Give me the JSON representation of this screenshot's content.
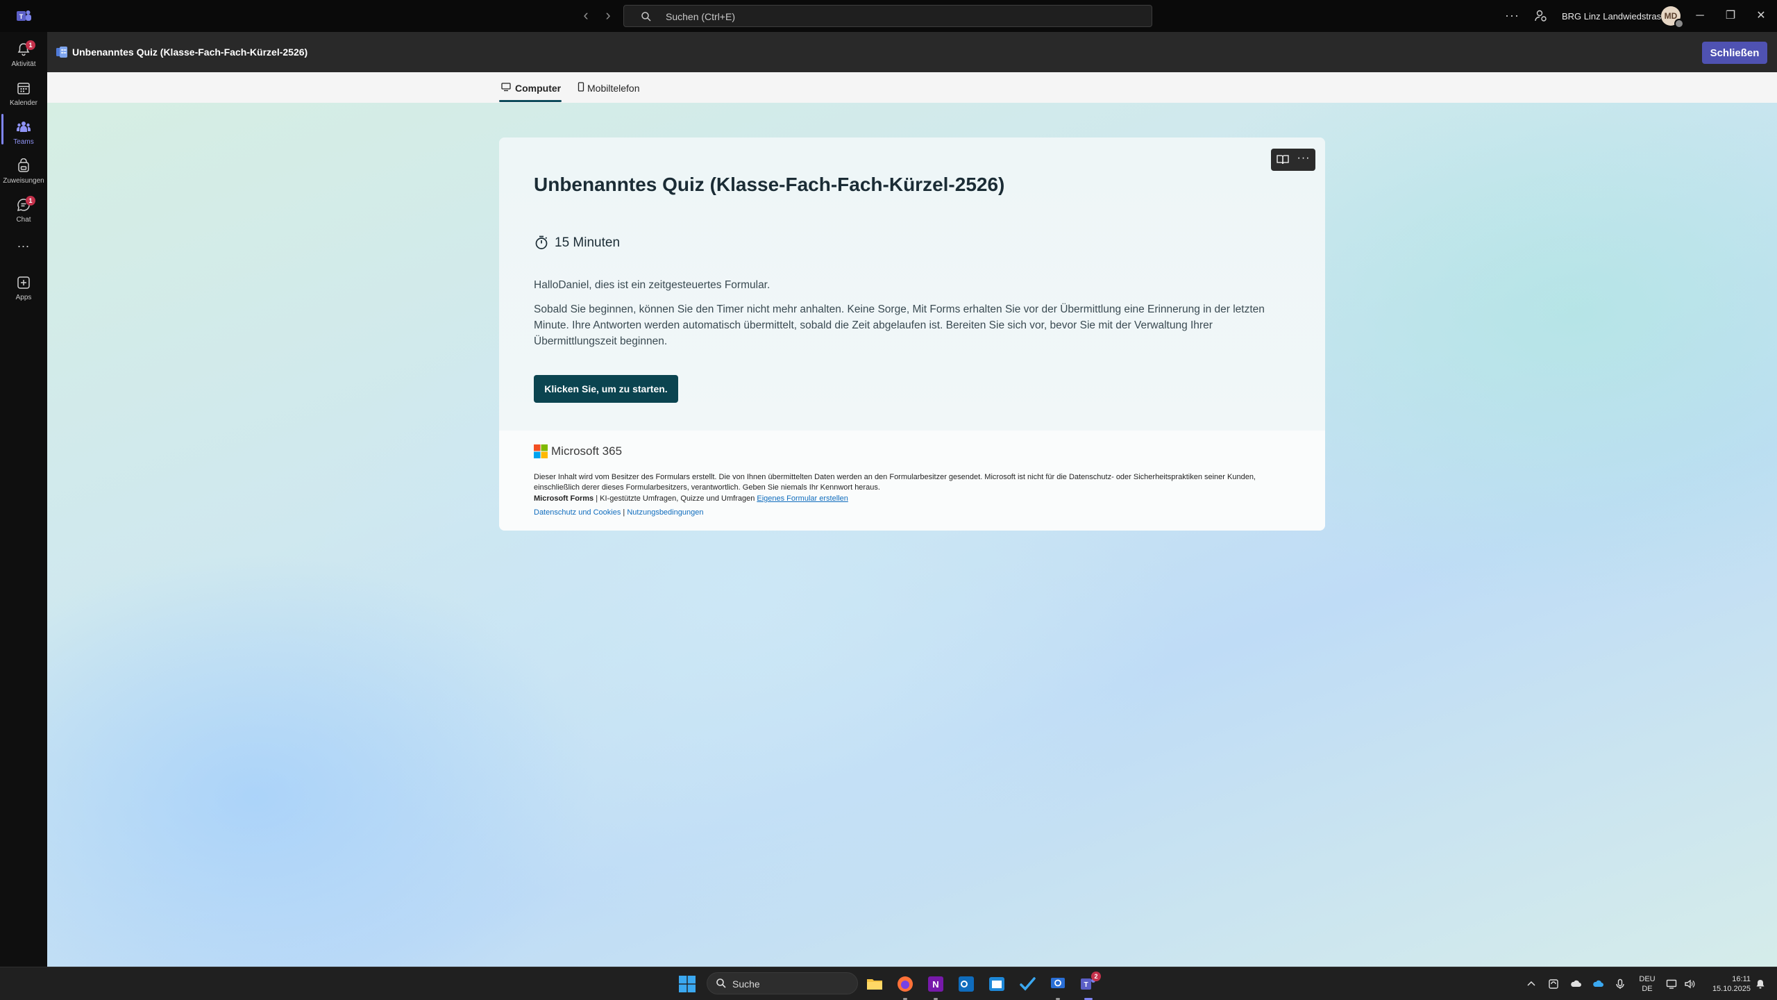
{
  "titlebar": {
    "search_placeholder": "Suchen (Ctrl+E)",
    "org_name": "BRG Linz Landwiedstrasse",
    "avatar_initials": "MD"
  },
  "rail": {
    "items": [
      {
        "label": "Aktivität",
        "badge": "1"
      },
      {
        "label": "Kalender"
      },
      {
        "label": "Teams"
      },
      {
        "label": "Zuweisungen"
      },
      {
        "label": "Chat",
        "badge": "1"
      },
      {
        "label": "Apps"
      }
    ],
    "more": "..."
  },
  "header": {
    "title": "Unbenanntes Quiz (Klasse-Fach-Fach-Kürzel-2526)",
    "close_label": "Schließen"
  },
  "tabs": [
    {
      "label": "Computer"
    },
    {
      "label": "Mobiltelefon"
    }
  ],
  "form": {
    "title": "Unbenanntes Quiz (Klasse-Fach-Fach-Kürzel-2526)",
    "duration": "15 Minuten",
    "greeting": "HalloDaniel, dies ist ein zeitgesteuertes Formular.",
    "description": "Sobald Sie beginnen, können Sie den Timer nicht mehr anhalten. Keine Sorge, Mit Forms erhalten Sie vor der Übermittlung eine Erinnerung in der letzten Minute. Ihre Antworten werden automatisch übermittelt, sobald die Zeit abgelaufen ist. Bereiten Sie sich vor, bevor Sie mit der Verwaltung Ihrer Übermittlungszeit beginnen.",
    "start_label": "Klicken Sie, um zu starten."
  },
  "footer": {
    "brand": "Microsoft 365",
    "disclaimer": "Dieser Inhalt wird vom Besitzer des Formulars erstellt. Die von Ihnen übermittelten Daten werden an den Formularbesitzer gesendet. Microsoft ist nicht für die Datenschutz- oder Sicherheitspraktiken seiner Kunden, einschließlich derer dieses Formularbesitzers, verantwortlich. Geben Sie niemals Ihr Kennwort heraus.",
    "forms_name": "Microsoft Forms",
    "forms_tagline": " | KI-gestützte Umfragen, Quizze und Umfragen ",
    "create_link": "Eigenes Formular erstellen",
    "privacy_link": "Datenschutz und Cookies",
    "separator": " | ",
    "terms_link": "Nutzungsbedingungen"
  },
  "taskbar": {
    "search_label": "Suche",
    "teams_badge": "2",
    "lang_top": "DEU",
    "lang_bottom": "DE",
    "time": "16:11",
    "date": "15.10.2025"
  },
  "colors": {
    "accent": "#4f52b2",
    "start_button": "#0b4450",
    "badge": "#c4314b"
  }
}
